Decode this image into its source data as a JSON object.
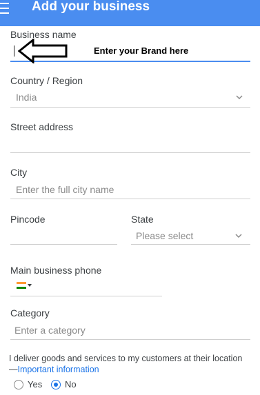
{
  "appbar": {
    "title": "Add your business"
  },
  "business_name": {
    "label": "Business name",
    "value": ""
  },
  "annotation": {
    "text": "Enter your Brand here"
  },
  "country": {
    "label": "Country / Region",
    "selected": "India"
  },
  "street": {
    "label": "Street address",
    "value": ""
  },
  "city": {
    "label": "City",
    "placeholder": "Enter the full city name"
  },
  "pincode": {
    "label": "Pincode",
    "value": ""
  },
  "state": {
    "label": "State",
    "placeholder": "Please select"
  },
  "phone": {
    "label": "Main business phone",
    "country_flag": "india-flag-icon"
  },
  "category": {
    "label": "Category",
    "placeholder": "Enter a category"
  },
  "delivery": {
    "question": "I deliver goods and services to my customers at their location",
    "prefix": "—",
    "link": "Important information",
    "options": [
      {
        "label": "Yes",
        "checked": false
      },
      {
        "label": "No",
        "checked": true
      }
    ]
  },
  "colors": {
    "appbar": "#4a8df0",
    "accent": "#1a73e8",
    "underline_active": "#4a8df0"
  }
}
